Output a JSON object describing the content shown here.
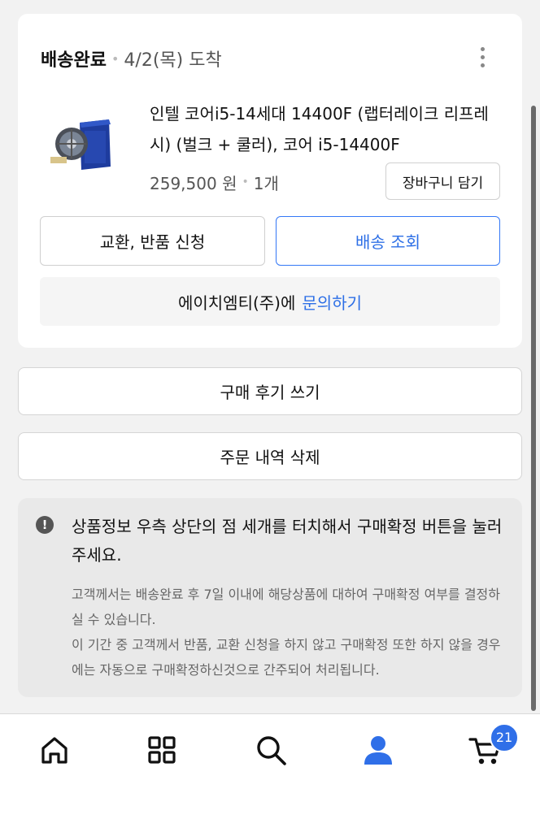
{
  "order": {
    "status": "배송완료",
    "date": "4/2(목) 도착",
    "product_name": "인텔 코어i5-14세대 14400F (랩터레이크 리프레시) (벌크 + 쿨러), 코어 i5-14400F",
    "price": "259,500 원",
    "quantity": "1개",
    "cart_button": "장바구니 담기",
    "return_button": "교환, 반품 신청",
    "track_button": "배송 조회",
    "seller": "에이치엠티(주)에",
    "inquiry_link": "문의하기"
  },
  "actions": {
    "review_button": "구매 후기 쓰기",
    "delete_button": "주문 내역 삭제"
  },
  "notice": {
    "main": "상품정보 우측 상단의 점 세개를 터치해서 구매확정 버튼을 눌러주세요.",
    "sub": "고객께서는 배송완료 후 7일 이내에 해당상품에 대하여 구매확정 여부를 결정하실 수 있습니다.\n이 기간 중 고객께서 반품, 교환 신청을 하지 않고 구매확정 또한 하지 않을 경우에는 자동으로 구매확정하신것으로 간주되어 처리됩니다."
  },
  "bottom_nav": {
    "items": [
      "home-icon",
      "category-grid-icon",
      "search-icon",
      "my-account-icon",
      "cart-icon"
    ],
    "active": "my-account-icon",
    "cart_badge": "21"
  },
  "colors": {
    "accent": "#2d6fe6",
    "badge": "#2f6fe8",
    "background": "#f2f2f2"
  }
}
